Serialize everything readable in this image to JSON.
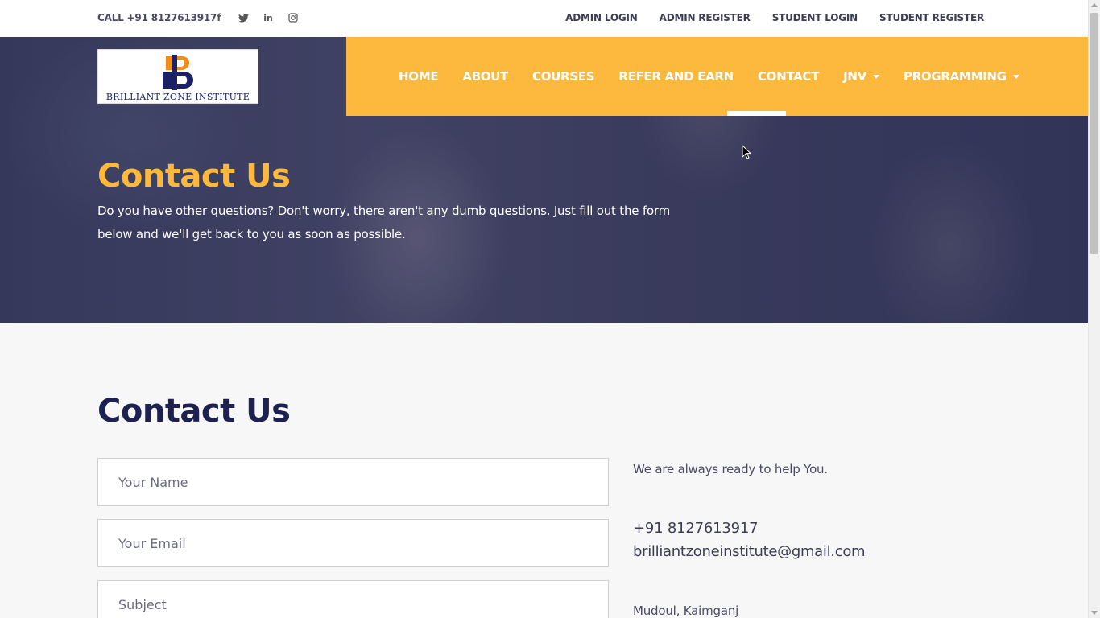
{
  "topbar": {
    "call": "CALL +91 8127613917",
    "social": [
      {
        "icon": "facebook-icon",
        "glyph": "f"
      },
      {
        "icon": "twitter-icon",
        "glyph": "t"
      },
      {
        "icon": "linkedin-icon",
        "glyph": "in"
      },
      {
        "icon": "instagram-icon",
        "glyph": "◎"
      }
    ],
    "links": [
      "ADMIN LOGIN",
      "ADMIN REGISTER",
      "STUDENT LOGIN",
      "STUDENT REGISTER"
    ]
  },
  "logo": {
    "name": "BRILLIANT ZONE INSTITUTE",
    "colors": {
      "orange": "#f28c1a",
      "navy": "#1c2166"
    }
  },
  "nav": {
    "items": [
      "HOME",
      "ABOUT",
      "COURSES",
      "REFER AND EARN",
      "CONTACT",
      "JNV",
      "PROGRAMMING"
    ],
    "active": "CONTACT",
    "accent": "#fdb93d"
  },
  "hero": {
    "title": "Contact Us",
    "text": "Do you have other questions? Don't worry, there aren't any dumb questions. Just fill out the form below and we'll get back to you as soon as possible."
  },
  "contact": {
    "title": "Contact Us",
    "form": {
      "name_placeholder": "Your Name",
      "email_placeholder": "Your Email",
      "subject_placeholder": "Subject"
    },
    "info": {
      "lead": "We are always ready to help You.",
      "phone": "+91 8127613917",
      "email": "brilliantzoneinstitute@gmail.com",
      "address": "Mudoul, Kaimganj"
    }
  }
}
